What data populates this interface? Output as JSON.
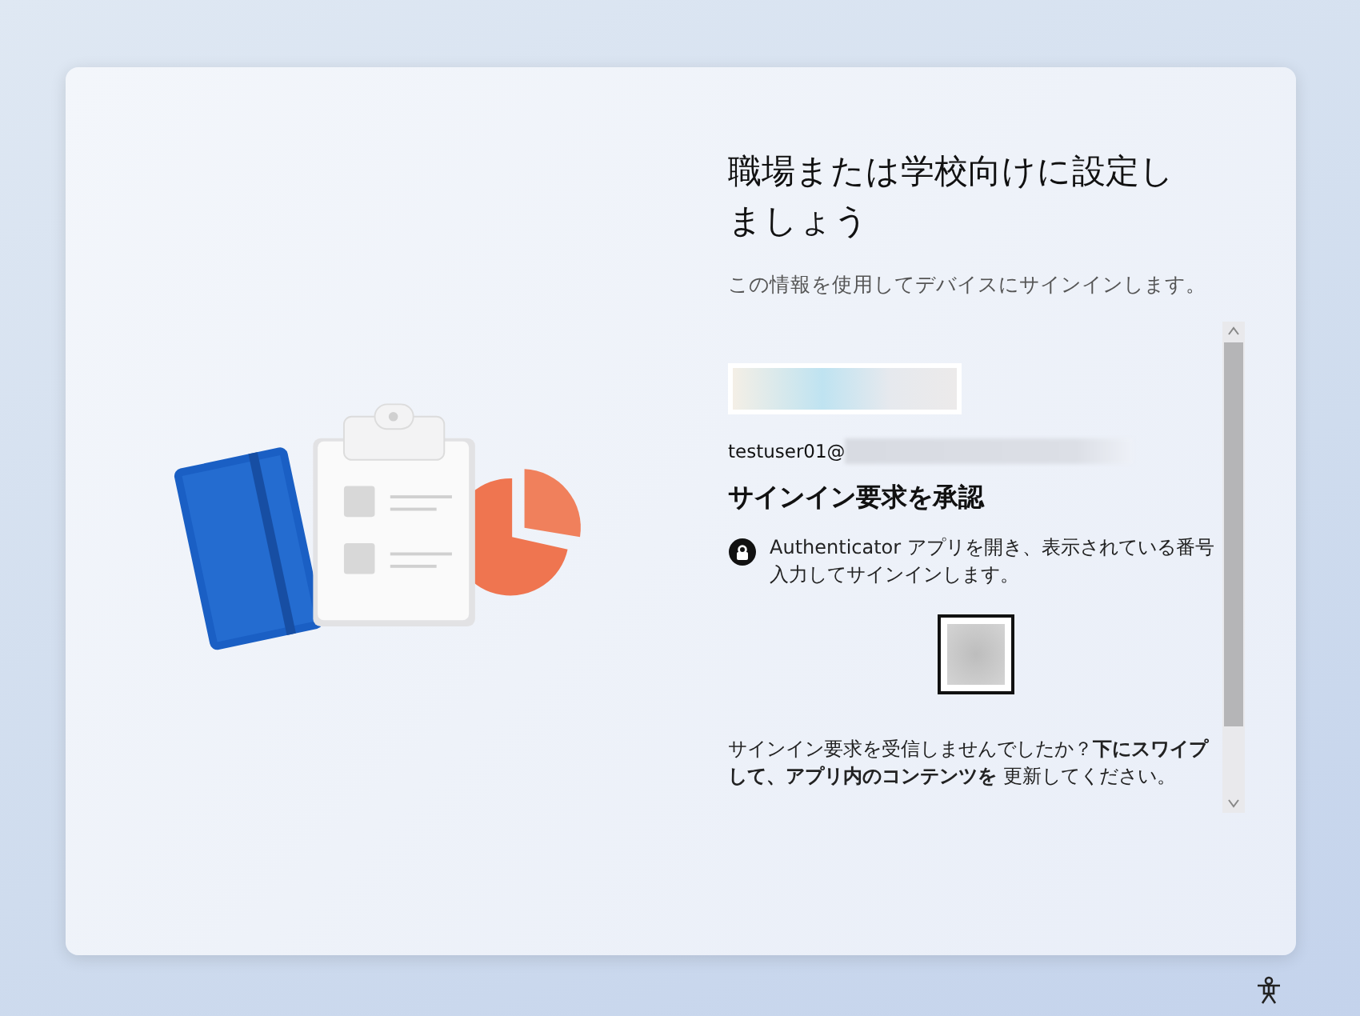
{
  "title": "職場または学校向けに設定しましょう",
  "subtitle": "この情報を使用してデバイスにサインインします。",
  "account": {
    "email_prefix": "testuser01@"
  },
  "heading": "サインイン要求を承認",
  "instruction": "Authenticator アプリを開き、表示されている番号入力してサインインします。",
  "help_text": "サインイン要求を受信しませんでしたか？**下にスワイプして、アプリ内のコンテンツを** 更新してください。"
}
